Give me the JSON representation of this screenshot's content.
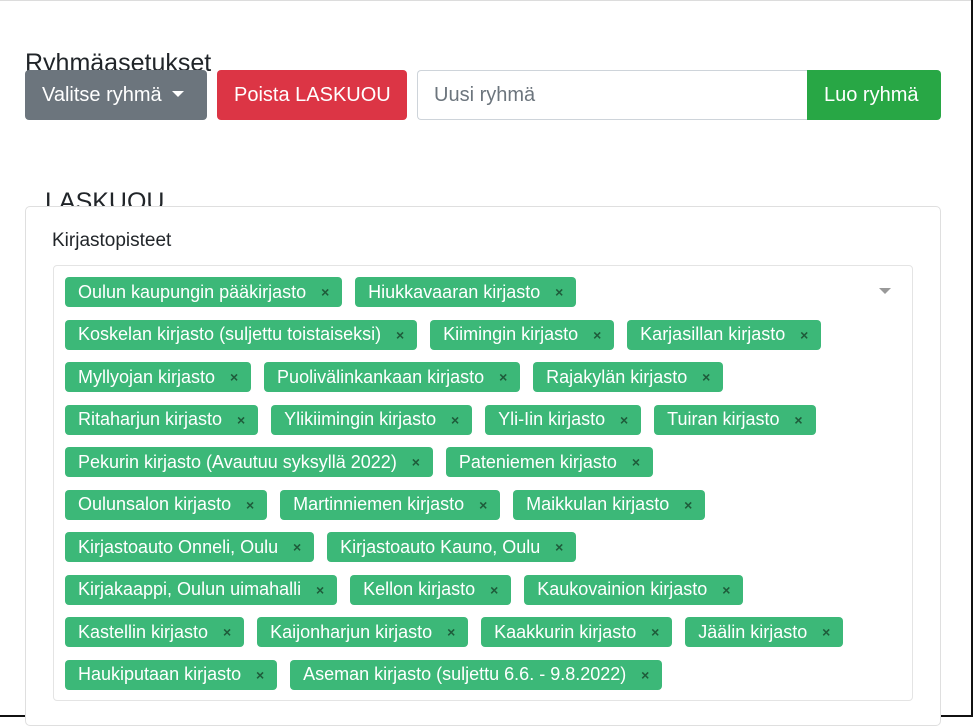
{
  "heading": "Ryhmäasetukset",
  "toolbar": {
    "select_label": "Valitse ryhmä",
    "delete_label": "Poista LASKUOU",
    "new_group_placeholder": "Uusi ryhmä",
    "create_label": "Luo ryhmä"
  },
  "group": {
    "title": "LASKUOU",
    "field_label": "Kirjastopisteet",
    "tags": [
      "Oulun kaupungin pääkirjasto",
      "Hiukkavaaran kirjasto",
      "Koskelan kirjasto (suljettu toistaiseksi)",
      "Kiimingin kirjasto",
      "Karjasillan kirjasto",
      "Myllyojan kirjasto",
      "Puolivälinkankaan kirjasto",
      "Rajakylän kirjasto",
      "Ritaharjun kirjasto",
      "Ylikiimingin kirjasto",
      "Yli-Iin kirjasto",
      "Tuiran kirjasto",
      "Pekurin kirjasto (Avautuu syksyllä 2022)",
      "Pateniemen kirjasto",
      "Oulunsalon kirjasto",
      "Martinniemen kirjasto",
      "Maikkulan kirjasto",
      "Kirjastoauto Onneli, Oulu",
      "Kirjastoauto Kauno, Oulu",
      "Kirjakaappi, Oulun uimahalli",
      "Kellon kirjasto",
      "Kaukovainion kirjasto",
      "Kastellin kirjasto",
      "Kaijonharjun kirjasto",
      "Kaakkurin kirjasto",
      "Jäälin kirjasto",
      "Haukiputaan kirjasto",
      "Aseman kirjasto (suljettu 6.6. - 9.8.2022)"
    ],
    "remove_symbol": "×"
  },
  "colors": {
    "select_button": "#6c757d",
    "delete_button": "#dc3545",
    "create_button": "#28a745",
    "tag": "#3cb878"
  }
}
